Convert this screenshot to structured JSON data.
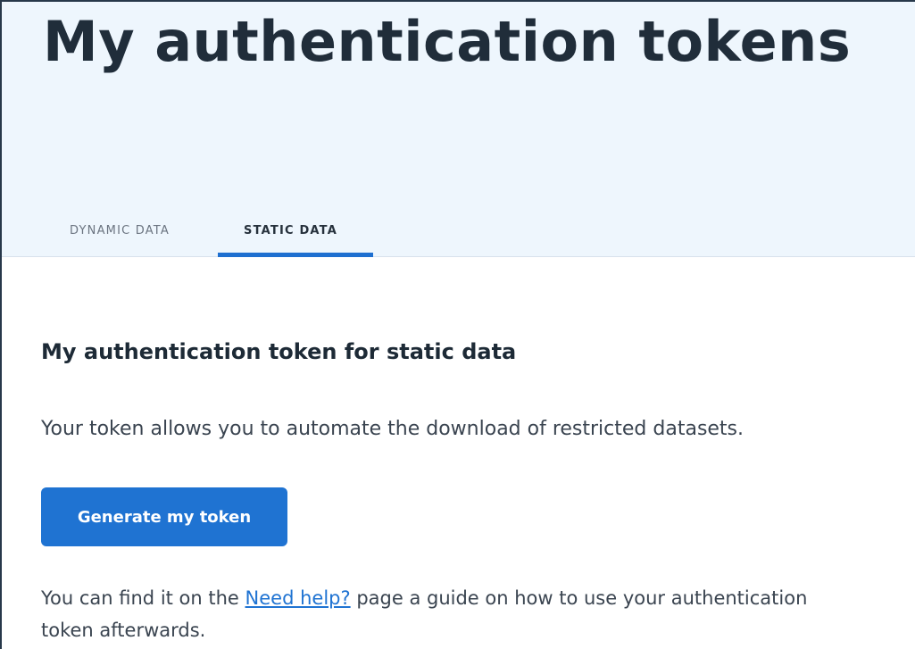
{
  "header": {
    "title": "My authentication tokens"
  },
  "tabs": [
    {
      "label": "DYNAMIC DATA",
      "active": false
    },
    {
      "label": "STATIC DATA",
      "active": true
    }
  ],
  "main": {
    "section_title": "My authentication token for static data",
    "intro": "Your token allows you to automate the download of restricted datasets.",
    "generate_button_label": "Generate my token",
    "help": {
      "before_link": "You can find it on the ",
      "link_text": "Need help?",
      "after_link": " page a guide on how to use your authentication",
      "second_line": "token afterwards."
    }
  },
  "colors": {
    "accent": "#1f73d2",
    "header_background": "#eef6fd",
    "title_text": "#202d3a"
  }
}
